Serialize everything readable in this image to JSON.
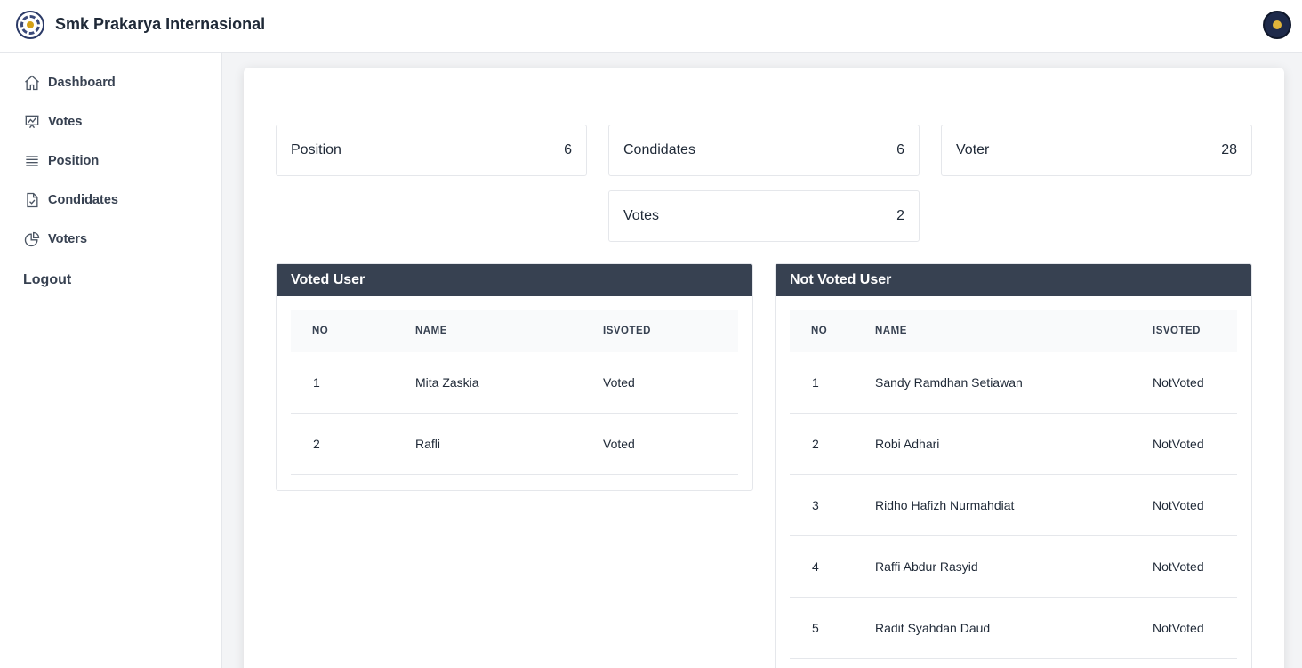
{
  "header": {
    "title": "Smk Prakarya Internasional"
  },
  "sidebar": {
    "items": [
      {
        "label": "Dashboard",
        "icon": "home-icon"
      },
      {
        "label": "Votes",
        "icon": "presentation-chart-icon"
      },
      {
        "label": "Position",
        "icon": "list-icon"
      },
      {
        "label": "Condidates",
        "icon": "document-check-icon"
      },
      {
        "label": "Voters",
        "icon": "pie-chart-icon"
      }
    ],
    "logout": "Logout"
  },
  "stats": {
    "position": {
      "label": "Position",
      "value": "6"
    },
    "condidates": {
      "label": "Condidates",
      "value": "6"
    },
    "voter": {
      "label": "Voter",
      "value": "28"
    },
    "votes": {
      "label": "Votes",
      "value": "2"
    }
  },
  "voted": {
    "title": "Voted User",
    "columns": [
      "NO",
      "NAME",
      "ISVOTED"
    ],
    "rows": [
      {
        "no": "1",
        "name": "Mita Zaskia",
        "status": "Voted"
      },
      {
        "no": "2",
        "name": "Rafli",
        "status": "Voted"
      }
    ]
  },
  "not_voted": {
    "title": "Not Voted User",
    "columns": [
      "NO",
      "NAME",
      "ISVOTED"
    ],
    "rows": [
      {
        "no": "1",
        "name": "Sandy Ramdhan Setiawan",
        "status": "NotVoted"
      },
      {
        "no": "2",
        "name": "Robi Adhari",
        "status": "NotVoted"
      },
      {
        "no": "3",
        "name": "Ridho Hafizh Nurmahdiat",
        "status": "NotVoted"
      },
      {
        "no": "4",
        "name": "Raffi Abdur Rasyid",
        "status": "NotVoted"
      },
      {
        "no": "5",
        "name": "Radit Syahdan Daud",
        "status": "NotVoted"
      }
    ]
  }
}
